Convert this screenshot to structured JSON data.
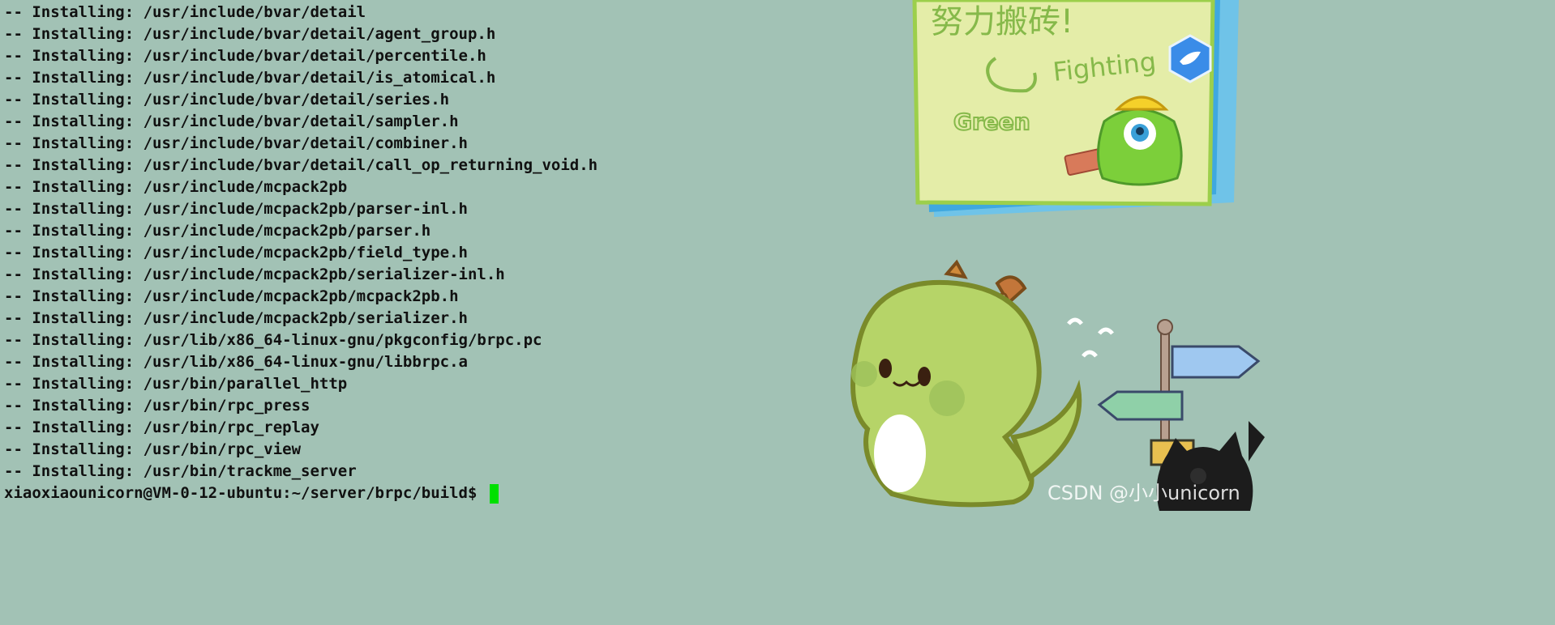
{
  "terminal": {
    "lines": [
      "-- Installing: /usr/include/bvar/detail",
      "-- Installing: /usr/include/bvar/detail/agent_group.h",
      "-- Installing: /usr/include/bvar/detail/percentile.h",
      "-- Installing: /usr/include/bvar/detail/is_atomical.h",
      "-- Installing: /usr/include/bvar/detail/series.h",
      "-- Installing: /usr/include/bvar/detail/sampler.h",
      "-- Installing: /usr/include/bvar/detail/combiner.h",
      "-- Installing: /usr/include/bvar/detail/call_op_returning_void.h",
      "-- Installing: /usr/include/mcpack2pb",
      "-- Installing: /usr/include/mcpack2pb/parser-inl.h",
      "-- Installing: /usr/include/mcpack2pb/parser.h",
      "-- Installing: /usr/include/mcpack2pb/field_type.h",
      "-- Installing: /usr/include/mcpack2pb/serializer-inl.h",
      "-- Installing: /usr/include/mcpack2pb/mcpack2pb.h",
      "-- Installing: /usr/include/mcpack2pb/serializer.h",
      "-- Installing: /usr/lib/x86_64-linux-gnu/pkgconfig/brpc.pc",
      "-- Installing: /usr/lib/x86_64-linux-gnu/libbrpc.a",
      "-- Installing: /usr/bin/parallel_http",
      "-- Installing: /usr/bin/rpc_press",
      "-- Installing: /usr/bin/rpc_replay",
      "-- Installing: /usr/bin/rpc_view",
      "-- Installing: /usr/bin/trackme_server"
    ],
    "prompt": "xiaoxiaounicorn@VM-0-12-ubuntu:~/server/brpc/build$ "
  },
  "wallpaper": {
    "note_heading": "努力搬砖!",
    "note_fighting": "Fighting",
    "note_green": "Green"
  },
  "watermark": "CSDN @小小unicorn",
  "colors": {
    "background": "#a2c2b5",
    "cursor": "#00e000",
    "note": "#e4eda8"
  }
}
